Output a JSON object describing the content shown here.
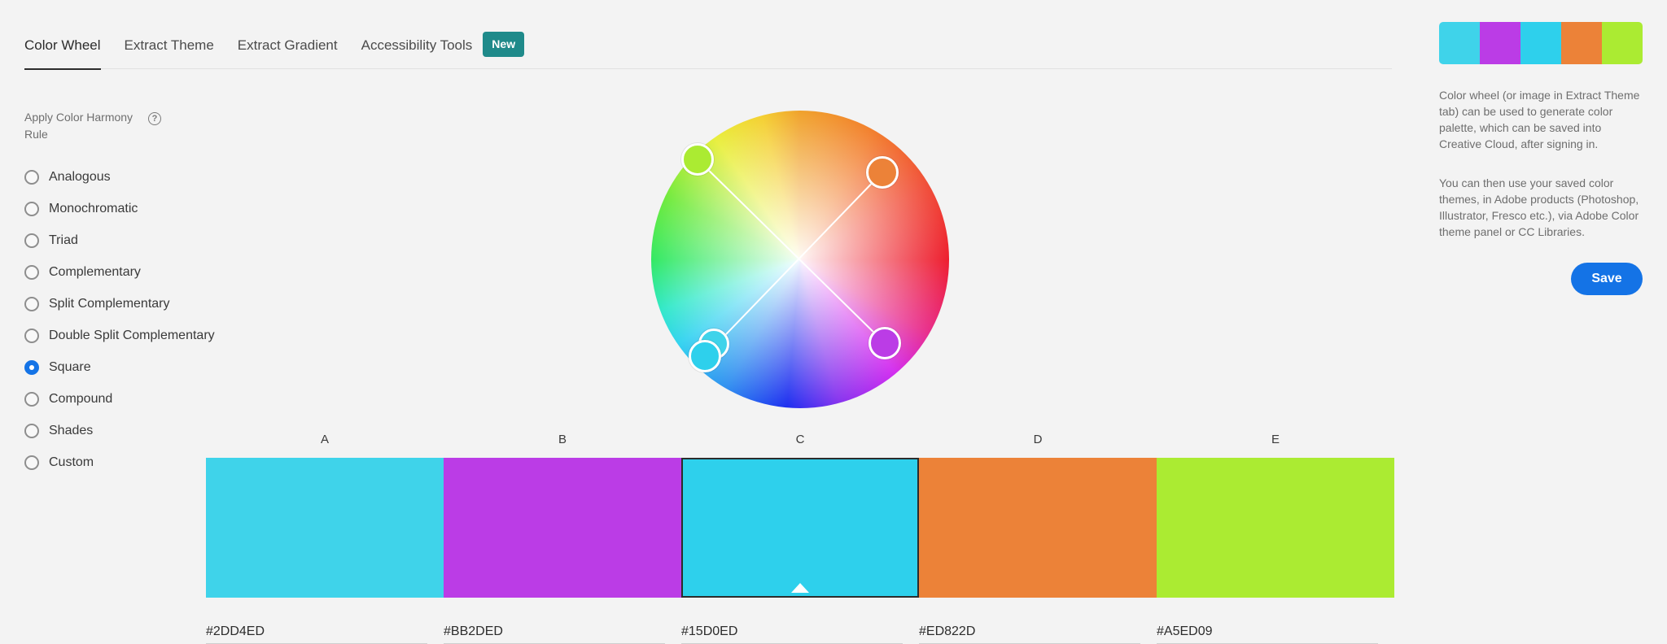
{
  "tabs": [
    {
      "label": "Color Wheel",
      "active": true
    },
    {
      "label": "Extract Theme"
    },
    {
      "label": "Extract Gradient"
    },
    {
      "label": "Accessibility Tools"
    }
  ],
  "badge": "New",
  "harmony": {
    "title": "Apply Color Harmony Rule",
    "help_glyph": "?",
    "rules": [
      "Analogous",
      "Monochromatic",
      "Triad",
      "Complementary",
      "Split Complementary",
      "Double Split Complementary",
      "Square",
      "Compound",
      "Shades",
      "Custom"
    ],
    "selected": "Square"
  },
  "swatches": [
    {
      "label": "A",
      "hex": "#2DD4ED",
      "color": "#3fd3ea"
    },
    {
      "label": "B",
      "hex": "#BB2DED",
      "color": "#bb3ce6"
    },
    {
      "label": "C",
      "hex": "#15D0ED",
      "color": "#2ed0ec",
      "selected": true
    },
    {
      "label": "D",
      "hex": "#ED822D",
      "color": "#ec8238"
    },
    {
      "label": "E",
      "hex": "#A5ED09",
      "color": "#abeb32"
    }
  ],
  "info": {
    "paragraph1": "Color wheel (or image in Extract Theme tab) can be used to generate color palette, which can be saved into Creative Cloud, after signing in.",
    "paragraph2": "You can then use your saved color themes, in Adobe products (Photoshop, Illustrator, Fresco etc.), via Adobe Color theme panel or CC Libraries."
  },
  "save_label": "Save",
  "icons": {
    "help": "help-icon",
    "caret": "caret-up-icon"
  }
}
